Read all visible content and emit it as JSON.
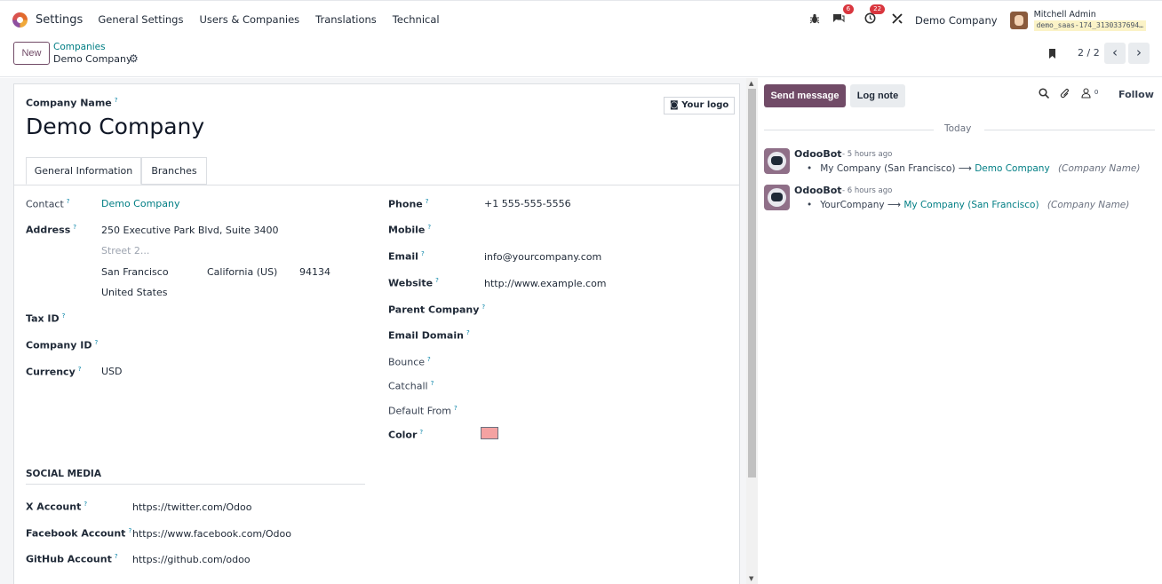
{
  "navbar": {
    "app_title": "Settings",
    "menu": [
      "General Settings",
      "Users & Companies",
      "Translations",
      "Technical"
    ],
    "messages_badge": "6",
    "activities_badge": "22",
    "company": "Demo Company",
    "user_name": "Mitchell Admin",
    "database": "demo_saas-174_3130337694…"
  },
  "control": {
    "new_label": "New",
    "breadcrumb_parent": "Companies",
    "breadcrumb_current": "Demo Company",
    "pager": "2 / 2"
  },
  "form": {
    "company_name_label": "Company Name",
    "company_name": "Demo Company",
    "logo_button": "Your logo",
    "tabs": [
      "General Information",
      "Branches"
    ],
    "left": {
      "contact_label": "Contact",
      "contact_value": "Demo Company",
      "address_label": "Address",
      "street": "250 Executive Park Blvd, Suite 3400",
      "street2_placeholder": "Street 2...",
      "city": "San Francisco",
      "state": "California (US)",
      "zip": "94134",
      "country": "United States",
      "tax_id_label": "Tax ID",
      "company_id_label": "Company ID",
      "currency_label": "Currency",
      "currency_value": "USD"
    },
    "right": {
      "phone_label": "Phone",
      "phone_value": "+1 555-555-5556",
      "mobile_label": "Mobile",
      "email_label": "Email",
      "email_value": "info@yourcompany.com",
      "website_label": "Website",
      "website_value": "http://www.example.com",
      "parent_label": "Parent Company",
      "email_domain_label": "Email Domain",
      "bounce_label": "Bounce",
      "catchall_label": "Catchall",
      "default_from_label": "Default From",
      "color_label": "Color",
      "color_value": "#f4a2a2"
    },
    "social": {
      "title": "SOCIAL MEDIA",
      "x_label": "X Account",
      "x_value": "https://twitter.com/Odoo",
      "facebook_label": "Facebook Account",
      "facebook_value": "https://www.facebook.com/Odoo",
      "github_label": "GitHub Account",
      "github_value": "https://github.com/odoo"
    }
  },
  "chatter": {
    "send_message": "Send message",
    "log_note": "Log note",
    "followers_count": "0",
    "follow": "Follow",
    "date_separator": "Today",
    "messages": [
      {
        "author": "OdooBot",
        "time": "- 5 hours ago",
        "old": "My Company (San Francisco)",
        "new": "Demo Company",
        "field": "(Company Name)"
      },
      {
        "author": "OdooBot",
        "time": "- 6 hours ago",
        "old": "YourCompany",
        "new": "My Company (San Francisco)",
        "field": "(Company Name)"
      }
    ]
  },
  "colors": {
    "brand": "#714b67",
    "link": "#017e84",
    "badge": "#d9363e"
  },
  "icons": [
    "odoo-logo-icon",
    "bug-icon",
    "chat-icon",
    "activity-clock-icon",
    "tools-icon",
    "gear-icon",
    "bookmark-icon",
    "chevron-left-icon",
    "chevron-right-icon",
    "camera-icon",
    "search-icon",
    "paperclip-icon",
    "followers-icon",
    "arrow-right-icon"
  ]
}
